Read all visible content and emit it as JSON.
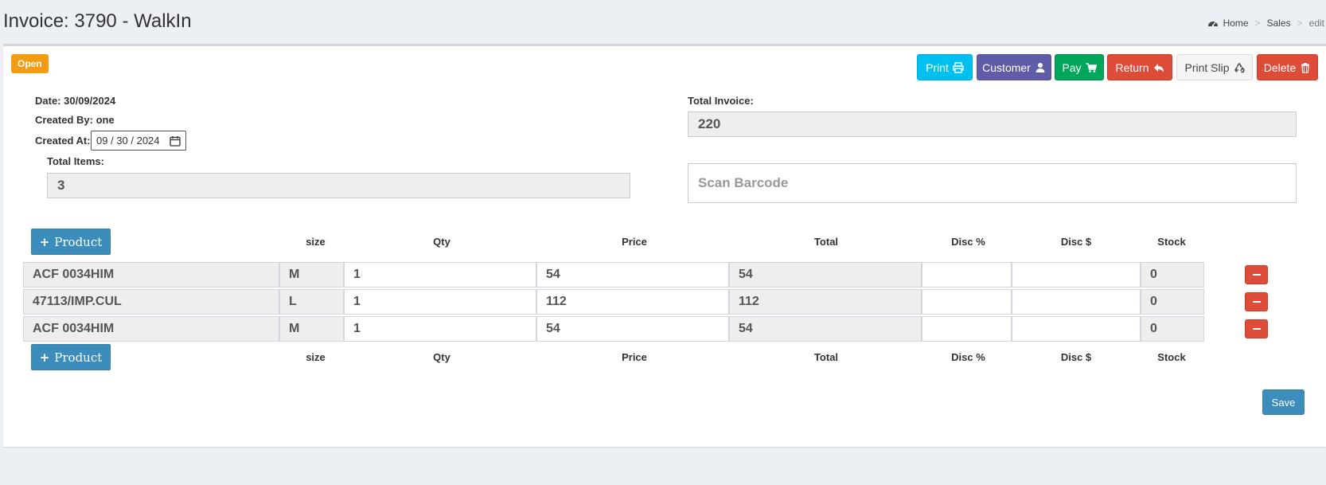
{
  "header": {
    "title": "Invoice: 3790 - WalkIn",
    "breadcrumb": [
      "Home",
      "Sales",
      "edit"
    ]
  },
  "status": "Open",
  "actions": {
    "print": "Print",
    "customer": "Customer",
    "pay": "Pay",
    "return": "Return",
    "print_slip": "Print Slip",
    "delete": "Delete"
  },
  "info": {
    "date": "Date: 30/09/2024",
    "created_by": "Created By: one",
    "created_at_label": "Created At:",
    "created_at_value": "09 / 30 / 2024",
    "total_items_label": "Total Items:",
    "total_items": "3",
    "total_invoice_label": "Total Invoice:",
    "total_invoice": "220",
    "scan_placeholder": "Scan Barcode"
  },
  "table": {
    "add_product_label": "Product",
    "columns": [
      "size",
      "Qty",
      "Price",
      "Total",
      "Disc %",
      "Disc $",
      "Stock"
    ],
    "rows": [
      {
        "product": "ACF 0034HIM",
        "size": "M",
        "qty": "1",
        "price": "54",
        "total": "54",
        "disc_pct": "",
        "disc_amt": "",
        "stock": "0"
      },
      {
        "product": "47113/IMP.CUL",
        "size": "L",
        "qty": "1",
        "price": "112",
        "total": "112",
        "disc_pct": "",
        "disc_amt": "",
        "stock": "0"
      },
      {
        "product": "ACF 0034HIM",
        "size": "M",
        "qty": "1",
        "price": "54",
        "total": "54",
        "disc_pct": "",
        "disc_amt": "",
        "stock": "0"
      }
    ]
  },
  "save_label": "Save",
  "colors": {
    "status_open": "#f39c12",
    "primary": "#3c8dbc",
    "info": "#00c0ef",
    "purple": "#605ca8",
    "success": "#00a65a",
    "danger": "#dd4b39"
  }
}
